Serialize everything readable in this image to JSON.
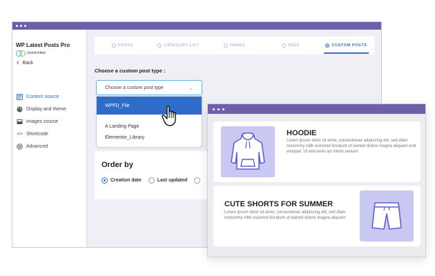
{
  "sidebar": {
    "app_title": "WP Latest Posts Pro",
    "brand": "JoomUnited",
    "back_label": "Back",
    "items": [
      {
        "label": "Content source",
        "icon": "content-source-icon",
        "active": true
      },
      {
        "label": "Display and theme",
        "icon": "palette-icon",
        "active": false
      },
      {
        "label": "Images source",
        "icon": "image-icon",
        "active": false
      },
      {
        "label": "Shortcode",
        "icon": "code-icon",
        "active": false
      },
      {
        "label": "Advanced",
        "icon": "advanced-icon",
        "active": false
      }
    ]
  },
  "tabs": [
    {
      "label": "POSTS",
      "active": false
    },
    {
      "label": "CATEGORY LIST",
      "active": false
    },
    {
      "label": "PAGES",
      "active": false
    },
    {
      "label": "TAGS",
      "active": false
    },
    {
      "label": "CUSTOM POSTS",
      "active": true
    }
  ],
  "cpt": {
    "label": "Choose a custom post type :",
    "select_value": "Choose a custom post type",
    "options": [
      "WPFD_File",
      "A Landing Page",
      "Elementor_Library"
    ],
    "selected_option": "WPFD_File"
  },
  "order": {
    "title": "Order by",
    "options": [
      {
        "label": "Creation date",
        "checked": true
      },
      {
        "label": "Last updated",
        "checked": false
      }
    ]
  },
  "preview": {
    "cards": [
      {
        "title": "HOODIE",
        "body": "Lorem ipsum dolor sit amet, consectetuer adipiscing elit, sed diam nonummy nibh euismod tincidunt ut laoreet dolore magna aliquam erat volutpat. Ut wisi enim ad minim veniam"
      },
      {
        "title": "CUTE SHORTS FOR SUMMER",
        "body": "Lorem ipsum dolor sit amet, consectetuer adipiscing elit, sed diam nonummy nibh euismod tincidunt ut laoreet dolore magna aliquam"
      }
    ]
  },
  "colors": {
    "titlebar": "#6e5fa8",
    "accent": "#2d6cc8",
    "thumb_bg": "#c8c8f3"
  }
}
